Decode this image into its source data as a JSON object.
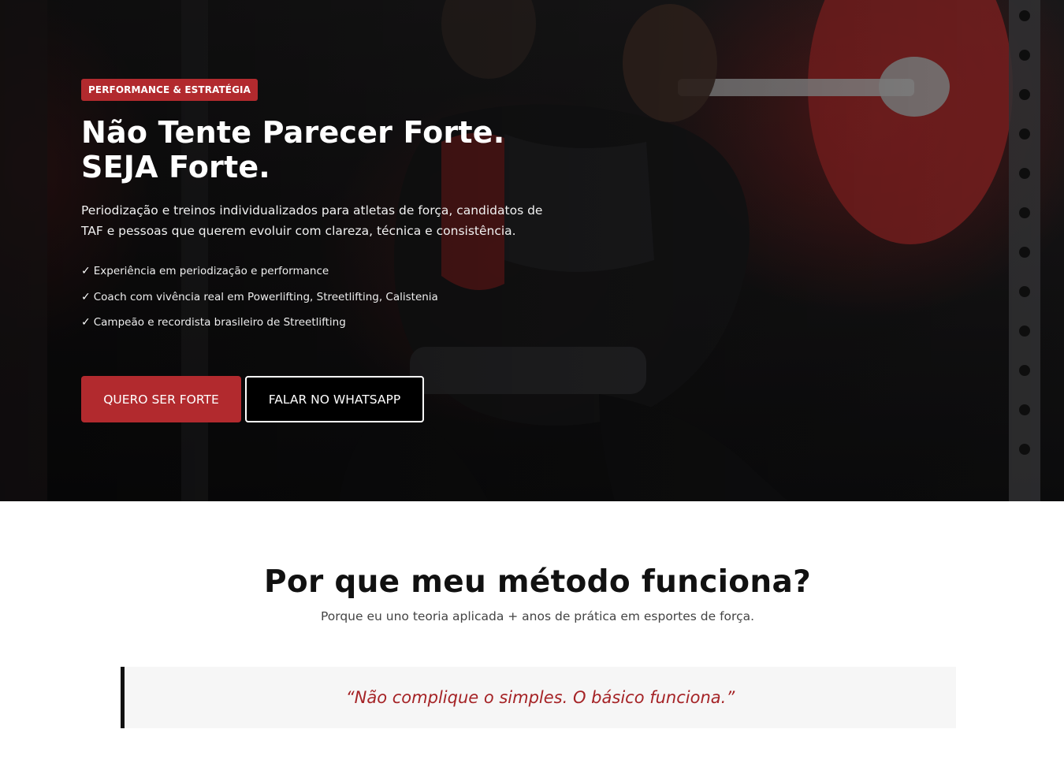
{
  "hero": {
    "badge": "PERFORMANCE & ESTRATÉGIA",
    "title_line1": "Não Tente Parecer Forte.",
    "title_line2": "SEJA Forte.",
    "description": "Periodização e treinos individualizados para atletas de força, candidatos de TAF e pessoas que querem evoluir com clareza, técnica e consistência.",
    "checklist": [
      {
        "icon": "check-icon",
        "mark": "✓",
        "text": "Experiência em periodização e performance"
      },
      {
        "icon": "check-icon",
        "mark": "✓",
        "text": "Coach com vivência real em Powerlifting, Streetlifting, Calistenia"
      },
      {
        "icon": "check-icon",
        "mark": "✓",
        "text": "Campeão e recordista brasileiro de Streetlifting"
      }
    ],
    "cta_primary": "QUERO SER FORTE",
    "cta_secondary": "FALAR NO WHATSAPP",
    "background_image": "athlete squatting with barbell in gym"
  },
  "method": {
    "title": "Por que meu método funciona?",
    "subtitle": "Porque eu uno teoria aplicada + anos de prática em esportes de força.",
    "quote": "“Não complique o simples. O básico funciona.”"
  },
  "colors": {
    "accent": "#b22a2e",
    "quote_text": "#a52326",
    "hero_bg": "#141314",
    "title_dark": "#111111"
  }
}
